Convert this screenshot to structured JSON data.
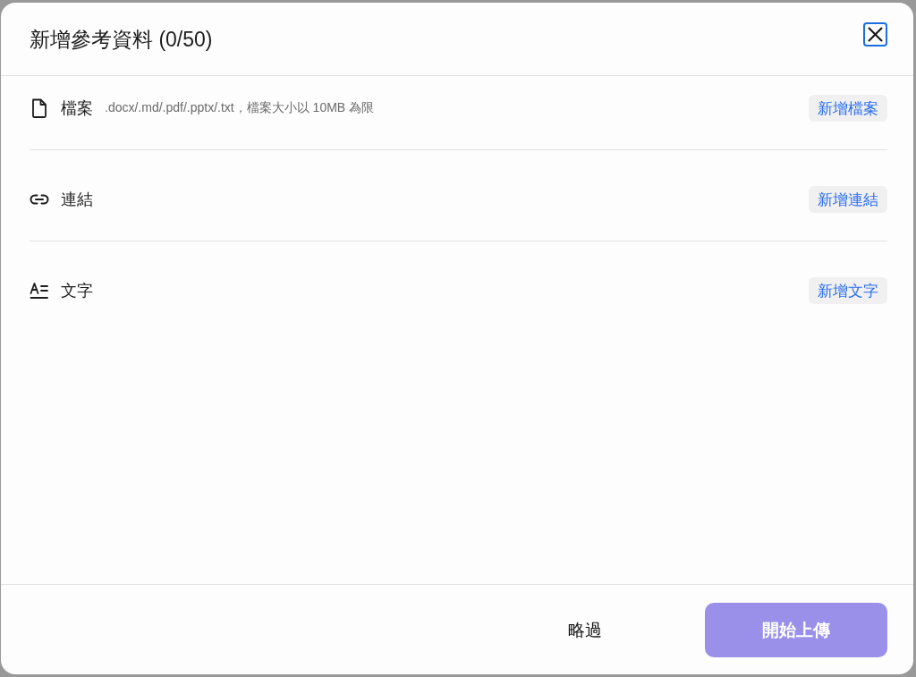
{
  "dialog": {
    "title": "新增參考資料 (0/50)",
    "close_button": {
      "focused": true
    }
  },
  "sources": [
    {
      "kind": "file",
      "label": "檔案",
      "hint": ".docx/.md/.pdf/.pptx/.txt，檔案大小以 10MB 為限",
      "action": "新增檔案"
    },
    {
      "kind": "link",
      "label": "連結",
      "action": "新增連結"
    },
    {
      "kind": "text",
      "label": "文字",
      "action": "新增文字"
    }
  ],
  "footer": {
    "skip": "略過",
    "upload": {
      "label": "開始上傳",
      "disabled": true
    }
  }
}
